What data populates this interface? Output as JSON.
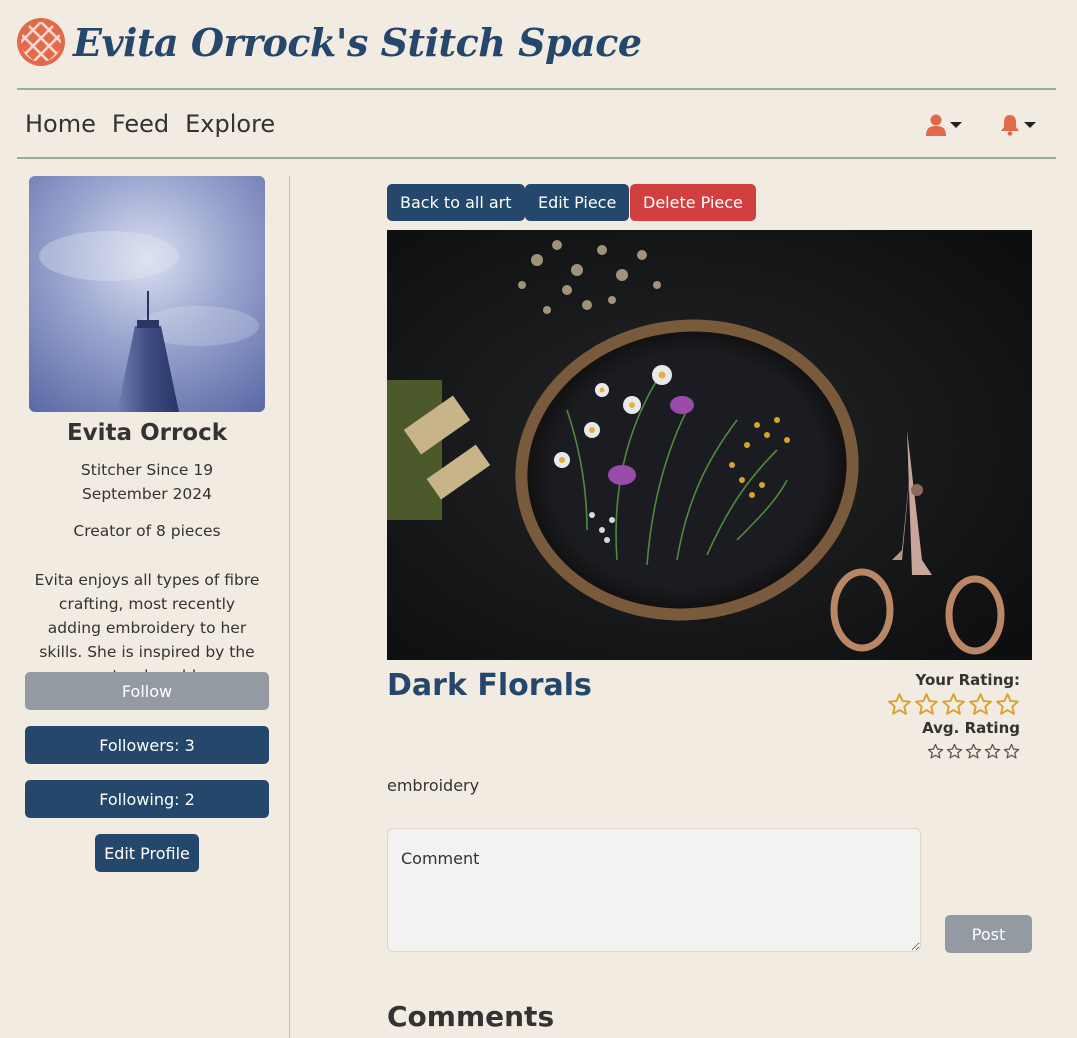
{
  "site": {
    "title": "Evita Orrock's Stitch Space"
  },
  "nav": {
    "links": [
      "Home",
      "Feed",
      "Explore"
    ],
    "user_icon": "user-icon",
    "bell_icon": "bell-icon"
  },
  "profile": {
    "name": "Evita Orrock",
    "since": "Stitcher Since 19 September 2024",
    "creator": "Creator of 8 pieces",
    "bio": "Evita enjoys all types of fibre crafting, most recently adding embroidery to her skills. She is inspired by the natural world.",
    "follow_label": "Follow",
    "followers_label": "Followers: 3",
    "following_label": "Following: 2",
    "edit_profile_label": "Edit Profile"
  },
  "piece": {
    "back_label": "Back to all art",
    "edit_label": "Edit Piece",
    "delete_label": "Delete Piece",
    "title": "Dark Florals",
    "your_rating_label": "Your Rating:",
    "your_rating": 0,
    "avg_rating_label": "Avg. Rating",
    "avg_rating": 0,
    "max_rating": 5,
    "tag": "embroidery"
  },
  "comment_form": {
    "placeholder": "Comment",
    "post_label": "Post"
  },
  "comments": {
    "heading": "Comments"
  },
  "colors": {
    "background": "#f2ebe1",
    "navy": "#24476b",
    "danger": "#d13f3f",
    "muted_button": "#939aa1",
    "accent_orange": "#e06a4a",
    "rule_green": "#8fb48f",
    "star_gold": "#d9a22a"
  }
}
